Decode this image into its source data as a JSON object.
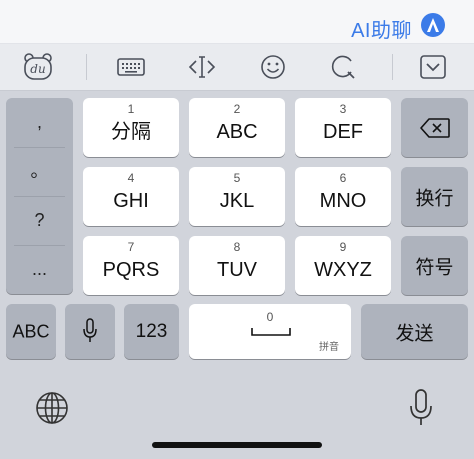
{
  "suggestion_bar": {
    "ai_label": "AI助聊"
  },
  "toolbar": {
    "items": [
      {
        "icon": "du-logo-icon",
        "text": "du"
      },
      {
        "icon": "keyboard-icon"
      },
      {
        "icon": "cursor-move-icon"
      },
      {
        "icon": "emoji-icon"
      },
      {
        "icon": "search-icon"
      },
      {
        "icon": "hide-keyboard-icon"
      }
    ]
  },
  "punctuation": [
    ",",
    "。",
    "?",
    "..."
  ],
  "keys": {
    "row1": [
      {
        "num": "1",
        "label": "分隔"
      },
      {
        "num": "2",
        "label": "ABC"
      },
      {
        "num": "3",
        "label": "DEF"
      }
    ],
    "row2": [
      {
        "num": "4",
        "label": "GHI"
      },
      {
        "num": "5",
        "label": "JKL"
      },
      {
        "num": "6",
        "label": "MNO"
      }
    ],
    "row3": [
      {
        "num": "7",
        "label": "PQRS"
      },
      {
        "num": "8",
        "label": "TUV"
      },
      {
        "num": "9",
        "label": "WXYZ"
      }
    ]
  },
  "side_keys": {
    "newline": "换行",
    "symbols": "符号"
  },
  "bottom_row": {
    "abc": "ABC",
    "num123": "123",
    "space_num": "0",
    "space_sub": "拼音",
    "send": "发送"
  },
  "colors": {
    "accent": "#3b7be8",
    "key_bg": "#ffffff",
    "dark_key_bg": "#aeb3bd",
    "board_bg": "#d1d4db"
  }
}
